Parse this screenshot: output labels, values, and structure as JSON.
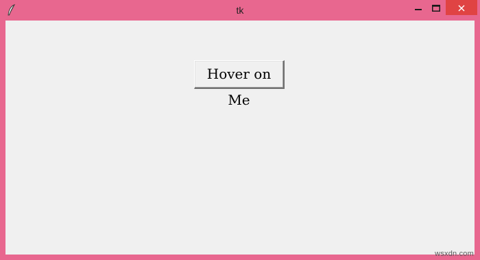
{
  "window": {
    "title": "tk",
    "frame_color": "#e8678f",
    "client_color": "#f0f0f0",
    "app_icon": "feather-icon",
    "controls": {
      "minimize_icon": "minimize-icon",
      "maximize_icon": "maximize-icon",
      "close_icon": "close-icon"
    }
  },
  "content": {
    "button_label": "Hover on Me"
  },
  "watermark": "wsxdn.com"
}
